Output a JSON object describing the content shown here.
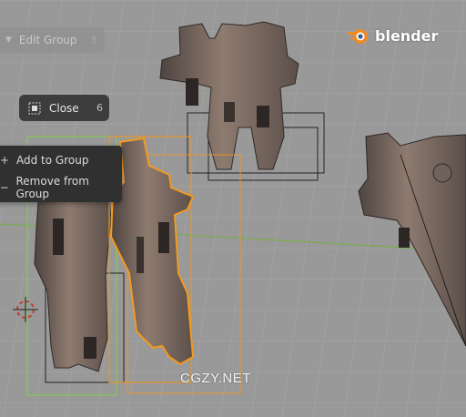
{
  "viewport": {
    "background": "#9a9a9a",
    "grid_color": "#a8a8a8",
    "x_axis_color": "#6fb03a",
    "selection_color": "#f29a1e",
    "secondary_selection_color": "#7fd14a",
    "mesh_color": "#6e5e55"
  },
  "edit_group_panel": {
    "label": "Edit Group",
    "shortcut": "⇧",
    "icon": "triangle-down-icon"
  },
  "close_button": {
    "label": "Close",
    "shortcut": "6",
    "icon": "group-icon"
  },
  "group_menu": {
    "items": [
      {
        "symbol": "+",
        "label": "Add to Group"
      },
      {
        "symbol": "−",
        "label": "Remove from Group"
      }
    ]
  },
  "brand": {
    "name": "blender",
    "logo_icon": "blender-logo-icon",
    "accent": "#f08a24"
  },
  "watermark": "CGZY.NET"
}
